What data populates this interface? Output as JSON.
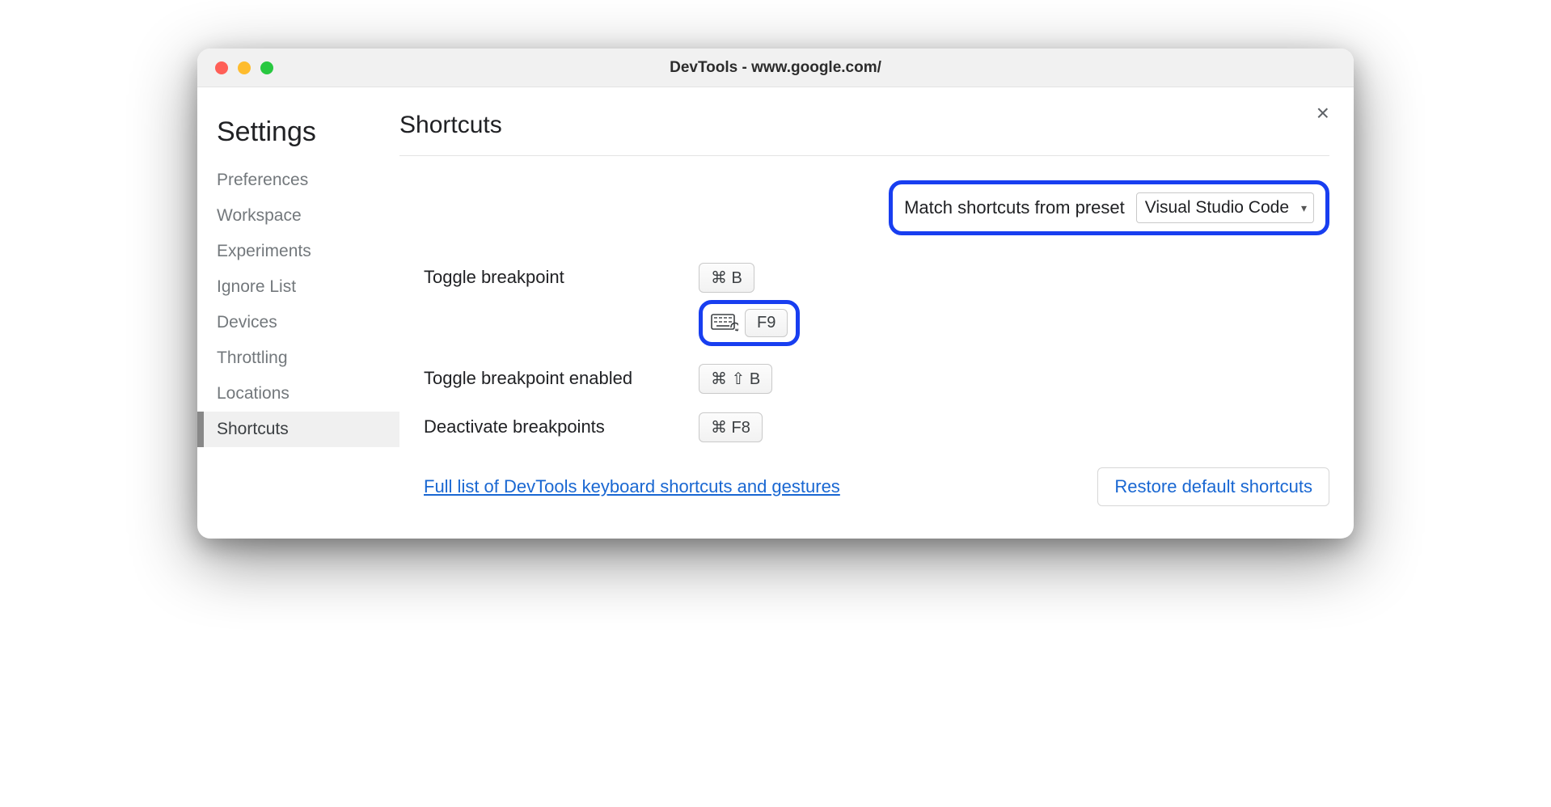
{
  "window": {
    "title": "DevTools - www.google.com/"
  },
  "sidebar": {
    "title": "Settings",
    "items": [
      {
        "label": "Preferences"
      },
      {
        "label": "Workspace"
      },
      {
        "label": "Experiments"
      },
      {
        "label": "Ignore List"
      },
      {
        "label": "Devices"
      },
      {
        "label": "Throttling"
      },
      {
        "label": "Locations"
      },
      {
        "label": "Shortcuts"
      }
    ],
    "active_index": 7
  },
  "main": {
    "title": "Shortcuts",
    "preset_label": "Match shortcuts from preset",
    "preset_value": "Visual Studio Code",
    "shortcuts": [
      {
        "label": "Toggle breakpoint",
        "keys": "⌘ B",
        "extra_keys": "F9"
      },
      {
        "label": "Toggle breakpoint enabled",
        "keys": "⌘ ⇧ B"
      },
      {
        "label": "Deactivate breakpoints",
        "keys": "⌘ F8"
      }
    ],
    "footer_link": "Full list of DevTools keyboard shortcuts and gestures",
    "restore_button": "Restore default shortcuts"
  },
  "highlight_color": "#183ef0"
}
